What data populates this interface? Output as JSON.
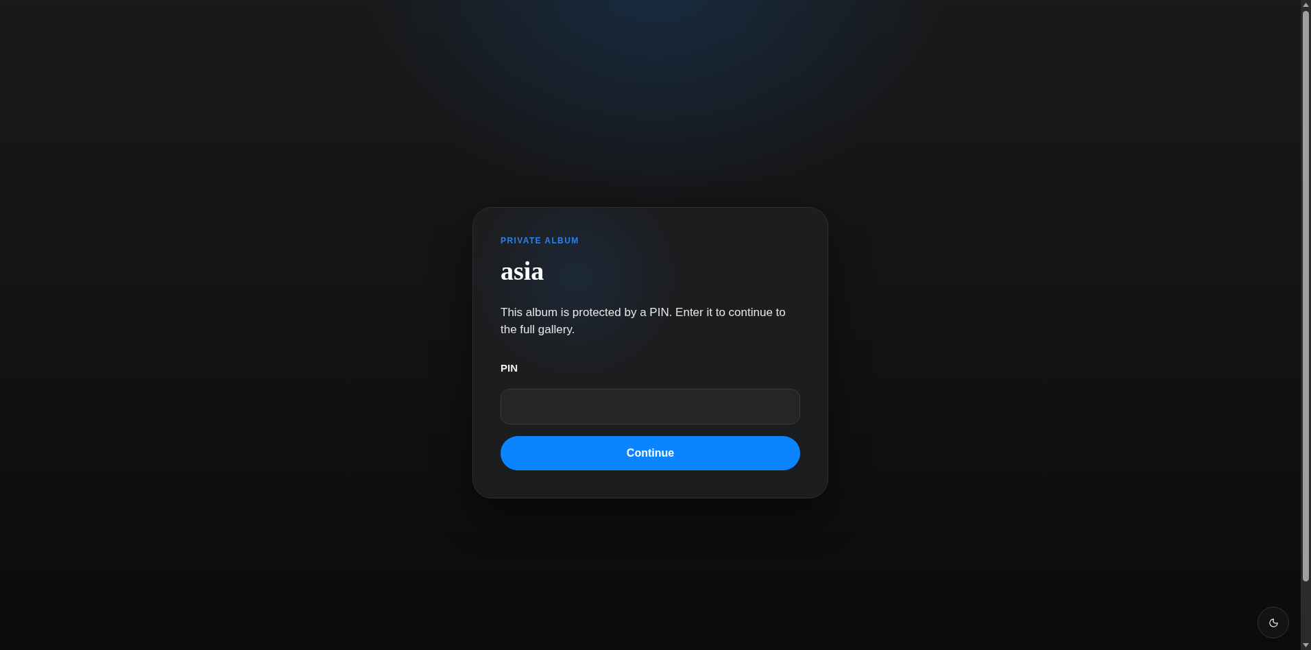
{
  "card": {
    "eyebrow": "PRIVATE ALBUM",
    "title": "asia",
    "description": "This album is protected by a PIN. Enter it to continue to the full gallery.",
    "pin_field": {
      "label": "PIN"
    },
    "submit_button": {
      "label": "Continue"
    }
  }
}
